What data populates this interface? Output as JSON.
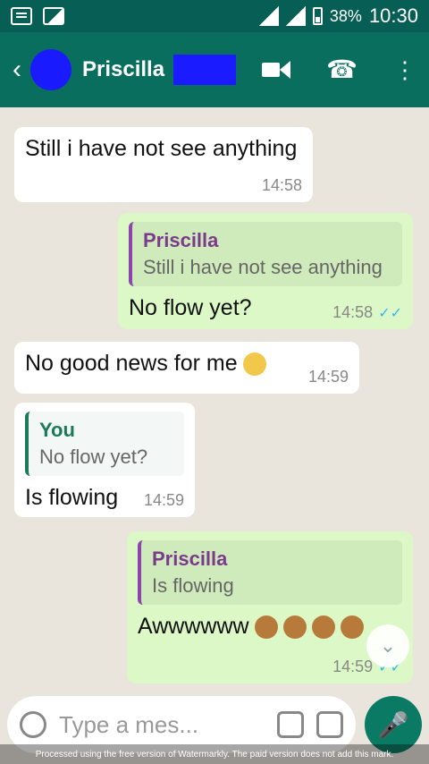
{
  "status": {
    "battery": "38%",
    "time": "10:30"
  },
  "header": {
    "contact_name": "Priscilla"
  },
  "messages": [
    {
      "text": "Still i have not see anything",
      "time": "14:58"
    },
    {
      "reply_name": "Priscilla",
      "reply_text": "Still i have not see anything",
      "text": "No flow yet?",
      "time": "14:58"
    },
    {
      "text": "No good news for me",
      "time": "14:59"
    },
    {
      "reply_name": "You",
      "reply_text": "No flow yet?",
      "text": "Is flowing",
      "time": "14:59"
    },
    {
      "reply_name": "Priscilla",
      "reply_text": "Is flowing",
      "text": "Awwwwww",
      "time": "14:59"
    }
  ],
  "input": {
    "placeholder": "Type a mes..."
  },
  "footer_note": "Processed using the free version of Watermarkly. The paid version does not add this mark."
}
